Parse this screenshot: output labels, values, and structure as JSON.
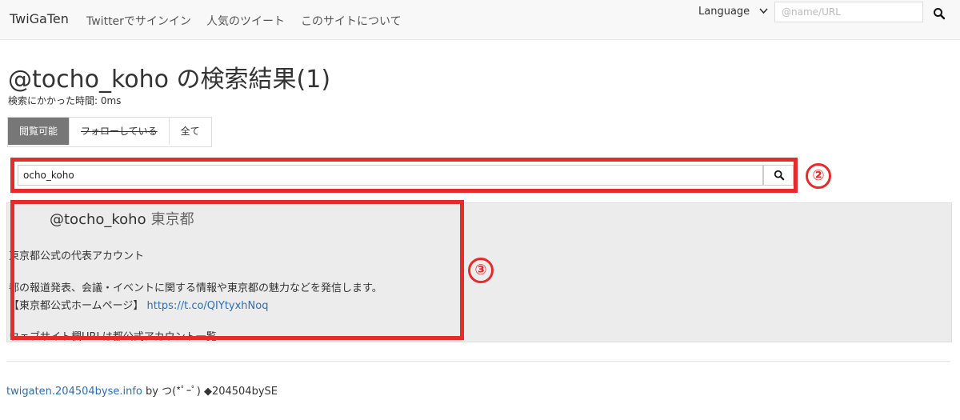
{
  "navbar": {
    "brand": "TwiGaTen",
    "links": [
      "Twitterでサインイン",
      "人気のツイート",
      "このサイトについて"
    ],
    "language_label": "Language",
    "search_placeholder": "@name/URL"
  },
  "header": {
    "title": "@tocho_koho の検索結果(1)",
    "timing": "検索にかかった時間: 0ms"
  },
  "filter_tabs": [
    {
      "label": "閲覧可能",
      "active": true
    },
    {
      "label": "フォローしている",
      "active": false
    },
    {
      "label": "全て",
      "active": false
    }
  ],
  "search": {
    "value": "ocho_koho",
    "marker": "②"
  },
  "result": {
    "handle": "@tocho_koho",
    "name": "東京都",
    "lines": [
      "東京都公式の代表アカウント",
      "都の報道発表、会議・イベントに関する情報や東京都の魅力などを発信します。",
      "【東京都公式ホームページ】",
      "ウェブサイト欄URLは都公式アカウント一覧"
    ],
    "link": "https://t.co/QIYtyxhNoq",
    "marker": "③"
  },
  "footer": {
    "site_link": "twigaten.204504byse.info",
    "by_text": "by つ(*ﾟｰﾟ) ◆204504bySE"
  },
  "colors": {
    "highlight": "#e62b2b",
    "link": "#2a6fb8",
    "active_tab": "#777777"
  }
}
